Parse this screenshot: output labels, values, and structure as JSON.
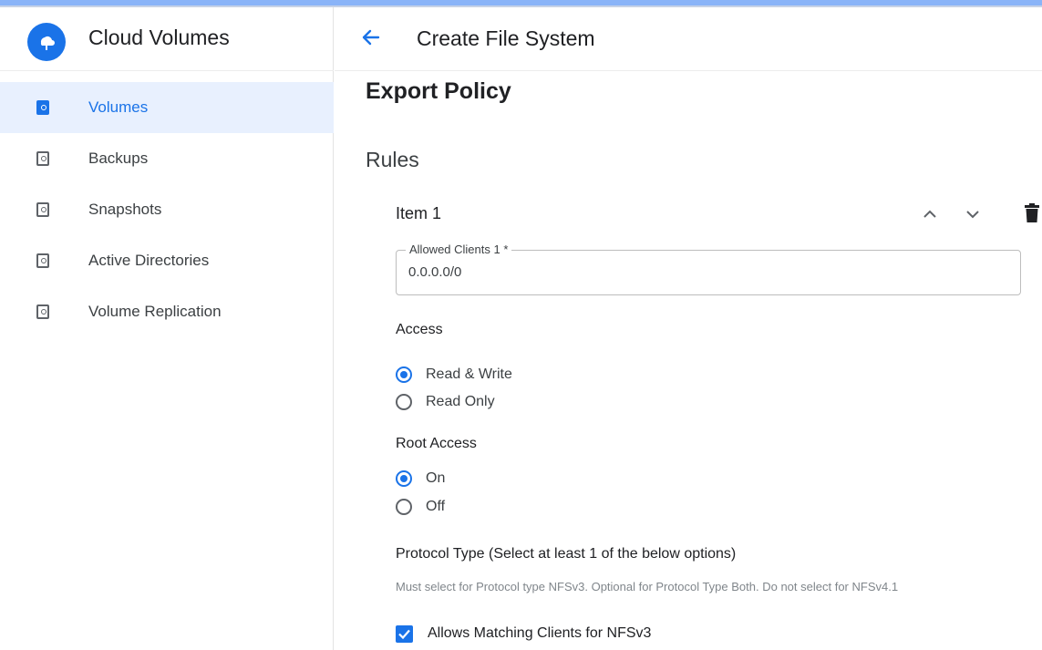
{
  "sidebar": {
    "app_title": "Cloud Volumes",
    "items": [
      {
        "label": "Volumes",
        "active": true
      },
      {
        "label": "Backups",
        "active": false
      },
      {
        "label": "Snapshots",
        "active": false
      },
      {
        "label": "Active Directories",
        "active": false
      },
      {
        "label": "Volume Replication",
        "active": false
      }
    ]
  },
  "header": {
    "title": "Create File System"
  },
  "form": {
    "section_title": "Export Policy",
    "rules_title": "Rules",
    "item": {
      "title": "Item 1",
      "allowed_clients": {
        "label": "Allowed Clients 1 *",
        "value": "0.0.0.0/0"
      },
      "access": {
        "label": "Access",
        "options": [
          "Read & Write",
          "Read Only"
        ],
        "selected": "Read & Write"
      },
      "root_access": {
        "label": "Root Access",
        "options": [
          "On",
          "Off"
        ],
        "selected": "On"
      },
      "protocol_type": {
        "label": "Protocol Type (Select at least 1 of the below options)",
        "hint": "Must select for Protocol type NFSv3. Optional for Protocol Type Both. Do not select for NFSv4.1",
        "checkbox_label": "Allows Matching Clients for NFSv3",
        "checked": true
      }
    }
  },
  "colors": {
    "accent": "#1a73e8",
    "active_bg": "#e8f0fe"
  },
  "icons": [
    "cloud-logo-icon",
    "volume-icon",
    "back-arrow-icon",
    "chevron-up-icon",
    "chevron-down-icon",
    "delete-icon",
    "check-icon"
  ]
}
